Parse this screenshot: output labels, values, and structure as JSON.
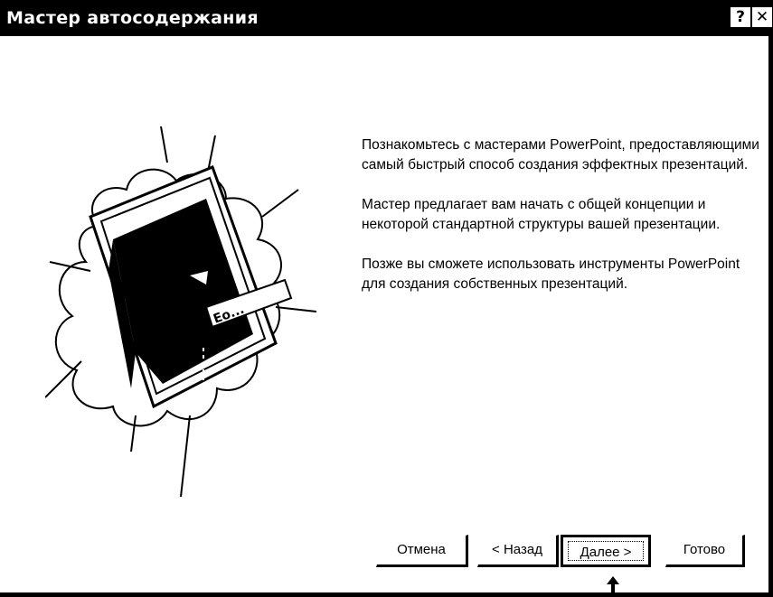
{
  "window": {
    "title": "Мастер автосодержания",
    "help_label": "?",
    "close_label": "✕"
  },
  "content": {
    "paragraphs": [
      "Познакомьтесь с мастерами PowerPoint, предоставляющими самый быстрый способ создания эффектных презентаций.",
      "Мастер предлагает вам начать с общей концепции и некоторой стандартной структуры вашей презентации.",
      "Позже вы сможете использовать инструменты PowerPoint для создания собственных презентаций."
    ]
  },
  "illustration": {
    "book_text": "Ео..."
  },
  "buttons": {
    "cancel": "Отмена",
    "back": "< Назад",
    "next": "Далее >",
    "finish": "Готово"
  },
  "colors": {
    "titlebar": "#000000",
    "background": "#ffffff"
  },
  "icons": {
    "pointer": "up-arrow-icon"
  }
}
